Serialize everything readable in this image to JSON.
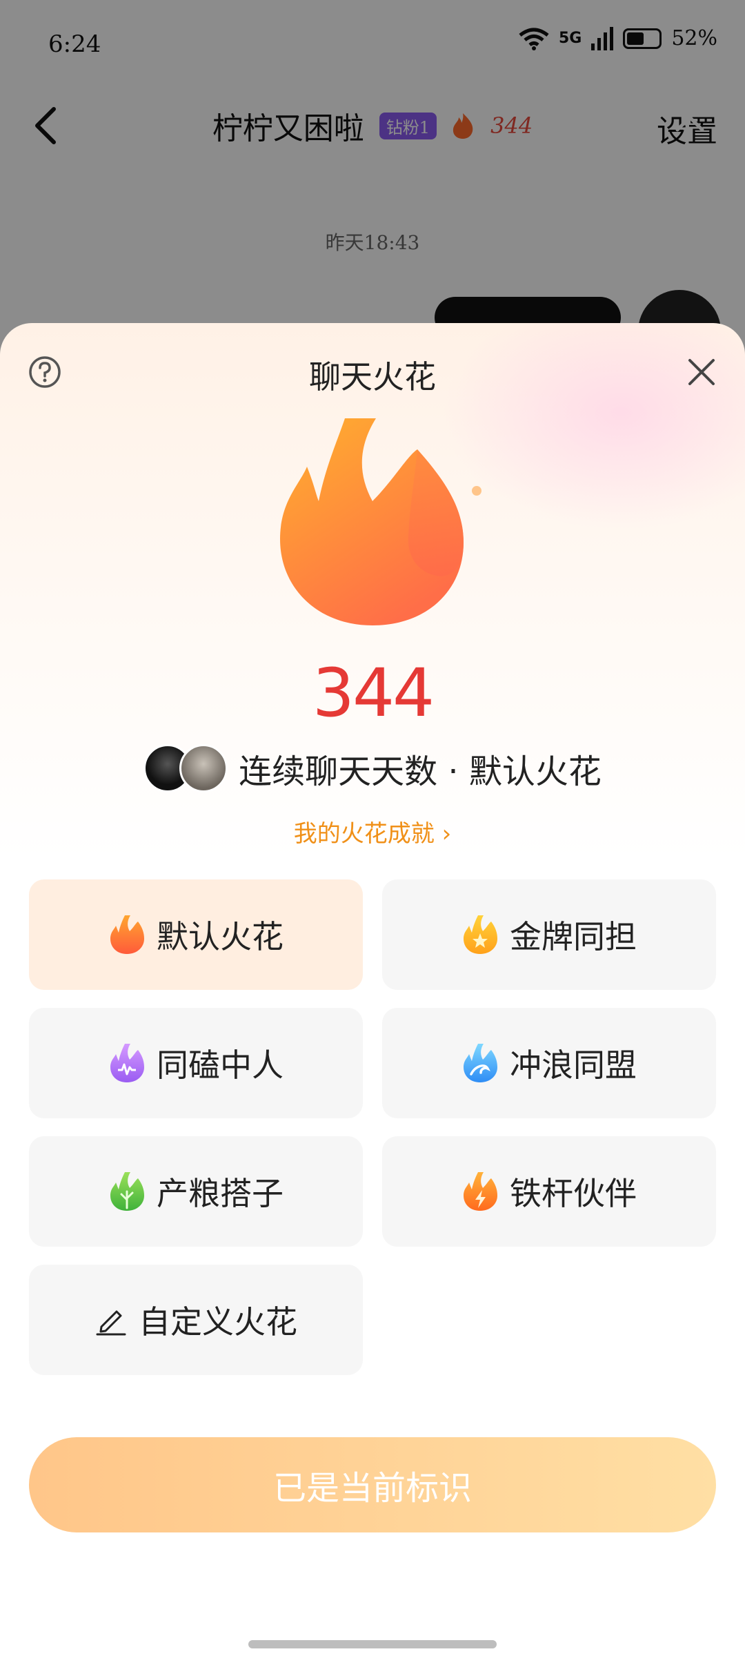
{
  "status_bar": {
    "time": "6:24",
    "network": "5G",
    "battery": "52%"
  },
  "chat_header": {
    "contact_name": "柠柠又困啦",
    "fan_badge": "钻粉1",
    "streak_count": "344",
    "settings_label": "设置"
  },
  "chat": {
    "timestamp": "昨天18:43"
  },
  "sheet": {
    "title": "聊天火花",
    "streak_count": "344",
    "description": "连续聊天天数 · 默认火花",
    "achievement_link": "我的火花成就 ›",
    "options": [
      {
        "label": "默认火花",
        "icon": "flame-orange-icon",
        "selected": true
      },
      {
        "label": "金牌同担",
        "icon": "flame-gold-star-icon",
        "selected": false
      },
      {
        "label": "同磕中人",
        "icon": "flame-purple-icon",
        "selected": false
      },
      {
        "label": "冲浪同盟",
        "icon": "flame-blue-wave-icon",
        "selected": false
      },
      {
        "label": "产粮搭子",
        "icon": "flame-green-leaf-icon",
        "selected": false
      },
      {
        "label": "铁杆伙伴",
        "icon": "flame-orange-bolt-icon",
        "selected": false
      },
      {
        "label": "自定义火花",
        "icon": "pencil-icon",
        "selected": false
      }
    ],
    "confirm_button": "已是当前标识"
  },
  "colors": {
    "accent_red": "#e53935",
    "accent_orange": "#f09018",
    "selected_bg": "#ffeee0",
    "button_gradient_start": "#ffc689",
    "button_gradient_end": "#ffdfa4"
  }
}
